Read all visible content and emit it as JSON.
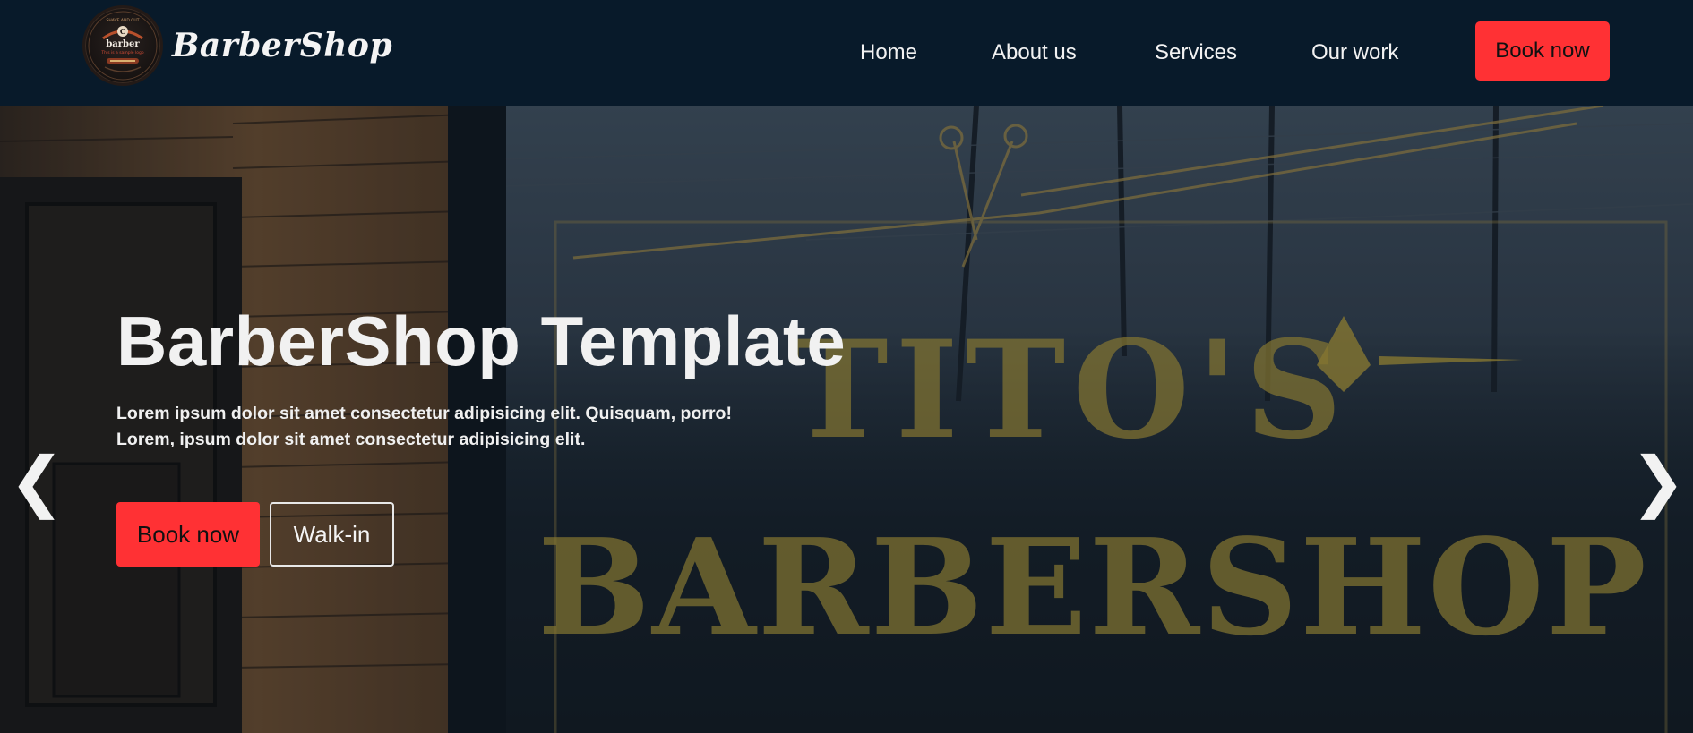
{
  "header": {
    "brand": "BarberShop",
    "logo": {
      "icon": "barber-logo-badge-icon",
      "top_text": "SHAVE AND CUT",
      "initial": "C",
      "name": "barber",
      "tagline": "This is a sample logo"
    },
    "nav": [
      {
        "label": "Home"
      },
      {
        "label": "About us"
      },
      {
        "label": "Services"
      },
      {
        "label": "Our work"
      }
    ],
    "book_label": "Book now"
  },
  "hero": {
    "title": "BarberShop Template",
    "text_line1": "Lorem ipsum dolor sit amet consectetur adipisicing elit. Quisquam, porro!",
    "text_line2": "Lorem, ipsum dolor sit amet consectetur adipisicing elit.",
    "book_label": "Book now",
    "walkin_label": "Walk-in",
    "prev_arrow": "❮",
    "next_arrow": "❯",
    "background_icon": "barbershop-window-photo",
    "background_sign": {
      "top_word": "TITO'S",
      "main_word": "BARBERSHOP"
    }
  },
  "colors": {
    "nav_bg": "#081a2a",
    "accent": "#ff3134",
    "text": "#f2f2f2",
    "sign_gold": "#c8ab3a"
  }
}
